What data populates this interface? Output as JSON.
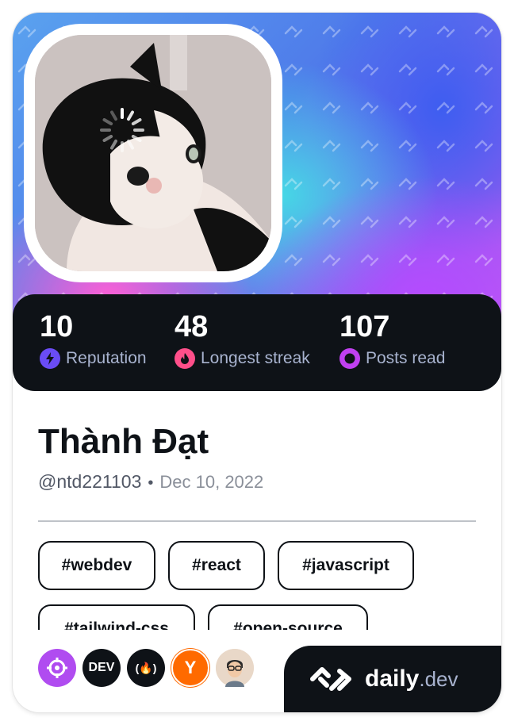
{
  "profile": {
    "name": "Thành Đạt",
    "handle": "@ntd221103",
    "separator": "•",
    "joined": "Dec 10, 2022",
    "avatar_subject": "black-and-white cat photo with loading spinner"
  },
  "stats": [
    {
      "value": "10",
      "label": "Reputation",
      "icon": "lightning-icon",
      "color": "#6a4cf5"
    },
    {
      "value": "48",
      "label": "Longest streak",
      "icon": "flame-icon",
      "color": "#ff4f8a"
    },
    {
      "value": "107",
      "label": "Posts read",
      "icon": "eye-icon",
      "color": "#c040f0"
    }
  ],
  "tags": [
    "#webdev",
    "#react",
    "#javascript",
    "#tailwind-css",
    "#open-source"
  ],
  "sources": [
    {
      "name": "crosshair-source-icon",
      "color": "#b04cf0"
    },
    {
      "name": "dev-source-icon",
      "label": "DEV",
      "color": "#0e1217"
    },
    {
      "name": "freecodecamp-source-icon",
      "label": "(🔥)",
      "color": "#0e1217"
    },
    {
      "name": "hackernews-source-icon",
      "label": "Y",
      "color": "#ff6a00"
    },
    {
      "name": "user-avatar-source-icon",
      "color": "#e8b48a"
    }
  ],
  "brand": {
    "word": "daily",
    "tld": ".dev"
  }
}
